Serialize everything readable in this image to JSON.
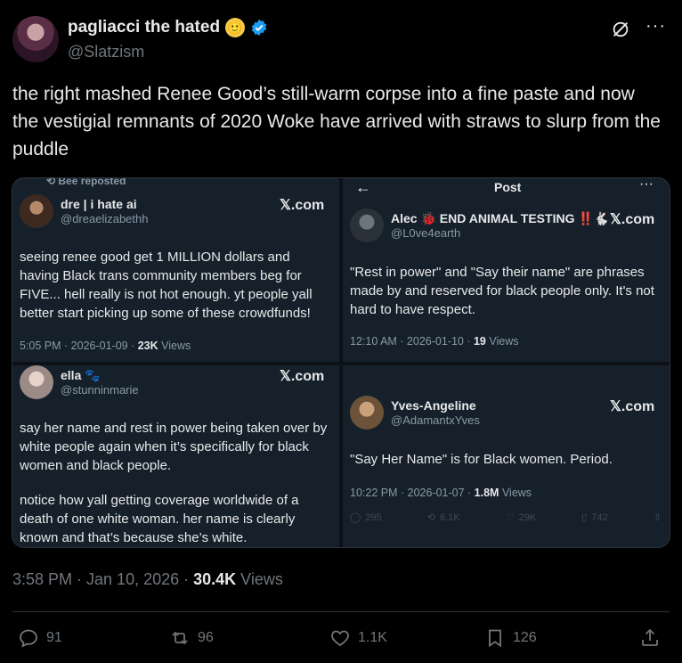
{
  "author": {
    "display_name": "pagliacci the hated",
    "handle": "@Slatzism",
    "emoji": "🙂"
  },
  "tweet": {
    "text": "the right mashed Renee Good’s still-warm corpse into a fine paste and now the vestigial remnants of 2020 Woke have arrived with straws to slurp from the puddle",
    "timestamp": "3:58 PM · Jan 10, 2026 · ",
    "views_count": "30.4K",
    "views_label": " Views"
  },
  "quotes": {
    "top_left": {
      "repost_label": "Bee reposted",
      "name": "dre | i hate ai",
      "handle": "@dreaelizabethh",
      "source": "𝕏.com",
      "body": "seeing renee good get 1 MILLION dollars and having Black trans community members beg for FIVE... hell really is not hot enough. yt people yall better start picking up some of these crowdfunds!",
      "meta": "5:05 PM · 2026-01-09 · ",
      "views_count": "23K",
      "views_label": " Views"
    },
    "top_right": {
      "header_title": "Post",
      "name": "Alec 🐞 END ANIMAL TESTING ‼️🐇",
      "handle": "@L0ve4earth",
      "source": "𝕏.com",
      "body": "\"Rest in power\" and \"Say their name\" are phrases made by and reserved for black people only. It's not hard to have respect.",
      "meta": "12:10 AM · 2026-01-10 · ",
      "views_count": "19",
      "views_label": " Views"
    },
    "bottom_left": {
      "name": "ella 🐾",
      "handle": "@stunninmarie",
      "source": "𝕏.com",
      "body1": "say her name and rest in power being taken over by white people again when it’s specifically for black women and black people.",
      "body2": "notice how yall getting coverage worldwide of a death of one white woman. her name is clearly known and that’s because she’s white."
    },
    "bottom_right": {
      "name": "Yves-Angeline",
      "handle": "@AdamantxYves",
      "source": "𝕏.com",
      "body": "\"Say Her Name\" is for Black women. Period.",
      "meta": "10:22 PM · 2026-01-07 · ",
      "views_count": "1.8M",
      "views_label": " Views",
      "replies": "295",
      "reposts": "6.1K",
      "likes": "29K",
      "bookmarks": "742"
    }
  },
  "actions": {
    "replies": "91",
    "reposts": "96",
    "likes": "1.1K",
    "bookmarks": "126"
  },
  "colors": {
    "background": "#000000",
    "verified": "#1d9bf0",
    "secondary_text": "#71767b",
    "quote_panel": "#15202b"
  }
}
